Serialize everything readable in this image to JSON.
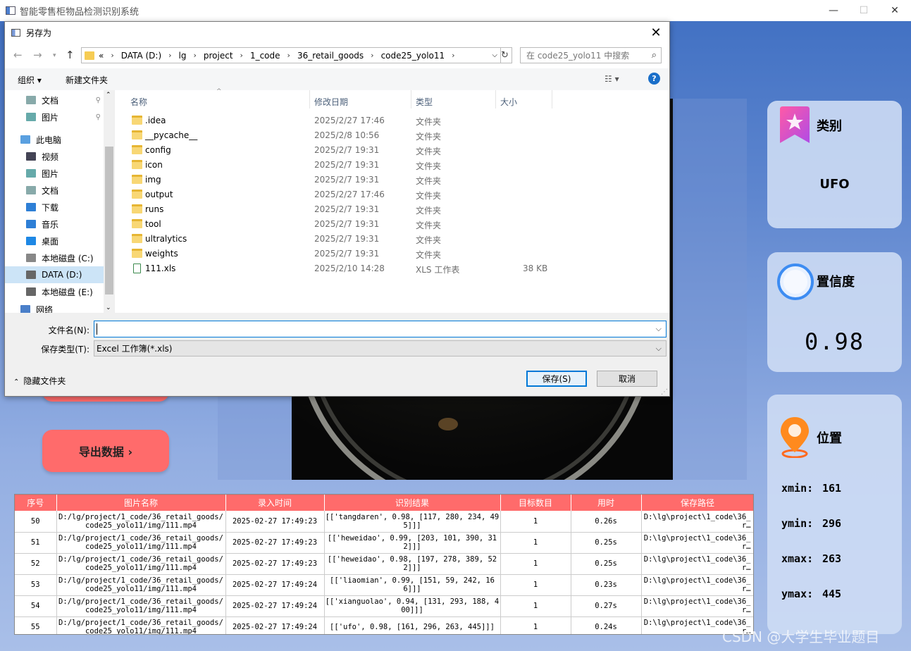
{
  "app": {
    "title": "智能零售柜物品检测识别系统",
    "minimize": "—",
    "maximize": "☐",
    "close": "✕"
  },
  "cards": {
    "category": {
      "label": "类别",
      "value": "UFO"
    },
    "confidence": {
      "label": "置信度",
      "value": "0.98"
    },
    "position": {
      "label": "位置",
      "xmin_label": "xmin:",
      "xmin": "161",
      "ymin_label": "ymin:",
      "ymin": "296",
      "xmax_label": "xmax:",
      "xmax": "263",
      "ymax_label": "ymax:",
      "ymax": "445"
    }
  },
  "buttons": {
    "export": "导出数据 ›"
  },
  "table": {
    "headers": [
      "序号",
      "图片名称",
      "录入时间",
      "识别结果",
      "目标数目",
      "用时",
      "保存路径"
    ],
    "rows": [
      {
        "id": "50",
        "name": "D:/lg/project/1_code/36_retail_goods/code25_yolo11/img/111.mp4",
        "time": "2025-02-27 17:49:23",
        "result": "[['tangdaren', 0.98, [117, 280, 234, 495]]]",
        "count": "1",
        "elapsed": "0.26s",
        "path": "D:\\lg\\project\\1_code\\36_r…"
      },
      {
        "id": "51",
        "name": "D:/lg/project/1_code/36_retail_goods/code25_yolo11/img/111.mp4",
        "time": "2025-02-27 17:49:23",
        "result": "[['heweidao', 0.99, [203, 101, 390, 312]]]",
        "count": "1",
        "elapsed": "0.25s",
        "path": "D:\\lg\\project\\1_code\\36_r…"
      },
      {
        "id": "52",
        "name": "D:/lg/project/1_code/36_retail_goods/code25_yolo11/img/111.mp4",
        "time": "2025-02-27 17:49:23",
        "result": "[['heweidao', 0.98, [197, 278, 389, 522]]]",
        "count": "1",
        "elapsed": "0.25s",
        "path": "D:\\lg\\project\\1_code\\36_r…"
      },
      {
        "id": "53",
        "name": "D:/lg/project/1_code/36_retail_goods/code25_yolo11/img/111.mp4",
        "time": "2025-02-27 17:49:24",
        "result": "[['liaomian', 0.99, [151, 59, 242, 166]]]",
        "count": "1",
        "elapsed": "0.23s",
        "path": "D:\\lg\\project\\1_code\\36_r…"
      },
      {
        "id": "54",
        "name": "D:/lg/project/1_code/36_retail_goods/code25_yolo11/img/111.mp4",
        "time": "2025-02-27 17:49:24",
        "result": "[['xianguolao', 0.94, [131, 293, 188, 400]]]",
        "count": "1",
        "elapsed": "0.27s",
        "path": "D:\\lg\\project\\1_code\\36_r…"
      },
      {
        "id": "55",
        "name": "D:/lg/project/1_code/36_retail_goods/code25_yolo11/img/111.mp4",
        "time": "2025-02-27 17:49:24",
        "result": "[['ufo', 0.98, [161, 296, 263, 445]]]",
        "count": "1",
        "elapsed": "0.24s",
        "path": "D:\\lg\\project\\1_code\\36_r…"
      }
    ]
  },
  "dialog": {
    "title": "另存为",
    "close": "✕",
    "breadcrumbs": [
      "«",
      "DATA (D:)",
      "lg",
      "project",
      "1_code",
      "36_retail_goods",
      "code25_yolo11"
    ],
    "search_placeholder": "在 code25_yolo11 中搜索",
    "toolbar": {
      "organize": "组织 ▾",
      "new_folder": "新建文件夹"
    },
    "nav": [
      {
        "label": "文档",
        "pinned": true
      },
      {
        "label": "图片",
        "pinned": true
      },
      {
        "label": "此电脑"
      },
      {
        "label": "视频"
      },
      {
        "label": "图片"
      },
      {
        "label": "文档"
      },
      {
        "label": "下载"
      },
      {
        "label": "音乐"
      },
      {
        "label": "桌面"
      },
      {
        "label": "本地磁盘 (C:)"
      },
      {
        "label": "DATA (D:)",
        "selected": true
      },
      {
        "label": "本地磁盘 (E:)"
      },
      {
        "label": "网络"
      }
    ],
    "columns": {
      "name": "名称",
      "date": "修改日期",
      "type": "类型",
      "size": "大小"
    },
    "files": [
      {
        "name": ".idea",
        "date": "2025/2/27 17:46",
        "type": "文件夹",
        "size": ""
      },
      {
        "name": "__pycache__",
        "date": "2025/2/8 10:56",
        "type": "文件夹",
        "size": ""
      },
      {
        "name": "config",
        "date": "2025/2/7 19:31",
        "type": "文件夹",
        "size": ""
      },
      {
        "name": "icon",
        "date": "2025/2/7 19:31",
        "type": "文件夹",
        "size": ""
      },
      {
        "name": "img",
        "date": "2025/2/7 19:31",
        "type": "文件夹",
        "size": ""
      },
      {
        "name": "output",
        "date": "2025/2/27 17:46",
        "type": "文件夹",
        "size": ""
      },
      {
        "name": "runs",
        "date": "2025/2/7 19:31",
        "type": "文件夹",
        "size": ""
      },
      {
        "name": "tool",
        "date": "2025/2/7 19:31",
        "type": "文件夹",
        "size": ""
      },
      {
        "name": "ultralytics",
        "date": "2025/2/7 19:31",
        "type": "文件夹",
        "size": ""
      },
      {
        "name": "weights",
        "date": "2025/2/7 19:31",
        "type": "文件夹",
        "size": ""
      },
      {
        "name": "111.xls",
        "date": "2025/2/10 14:28",
        "type": "XLS 工作表",
        "size": "38 KB"
      }
    ],
    "filename_label": "文件名(N):",
    "filename_value": "",
    "filetype_label": "保存类型(T):",
    "filetype_value": "Excel 工作簿(*.xls)",
    "hide_folders": "隐藏文件夹",
    "save": "保存(S)",
    "cancel": "取消"
  },
  "watermark": "CSDN @大学生毕业题目"
}
